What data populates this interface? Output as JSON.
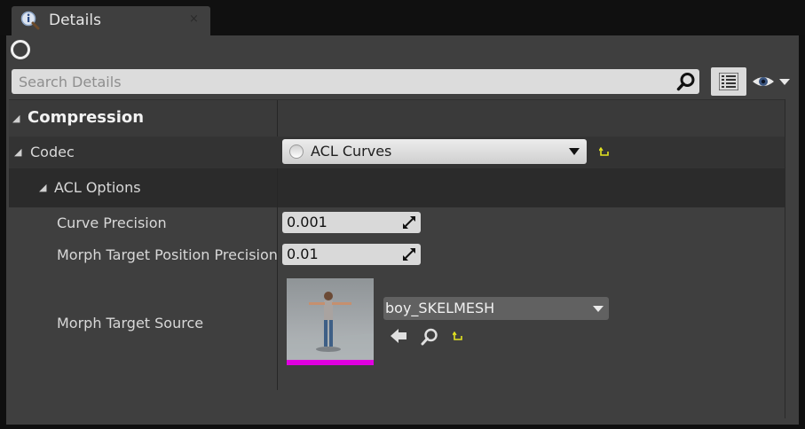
{
  "tab": {
    "title": "Details",
    "close": "×"
  },
  "search": {
    "placeholder": "Search Details",
    "value": ""
  },
  "category": {
    "title": "Compression"
  },
  "properties": {
    "codec_label": "Codec",
    "codec_value": "ACL Curves",
    "acl_options_label": "ACL Options",
    "curve_precision_label": "Curve Precision",
    "curve_precision_value": "0.001",
    "morph_precision_label": "Morph Target Position Precision",
    "morph_precision_value": "0.01",
    "morph_source_label": "Morph Target Source",
    "morph_source_value": "boy_SKELMESH"
  },
  "icons": {
    "tab": "info-magnifier-icon",
    "search": "search-icon",
    "view_options": "list-view-icon",
    "visibility": "eye-icon",
    "reset": "reset-to-default-icon",
    "use_selected": "arrow-left-icon",
    "browse": "browse-magnifier-icon"
  },
  "colors": {
    "panel": "#3f3f3f",
    "reset_icon": "#e3e320",
    "thumbnail_bar": "#e000e0"
  }
}
